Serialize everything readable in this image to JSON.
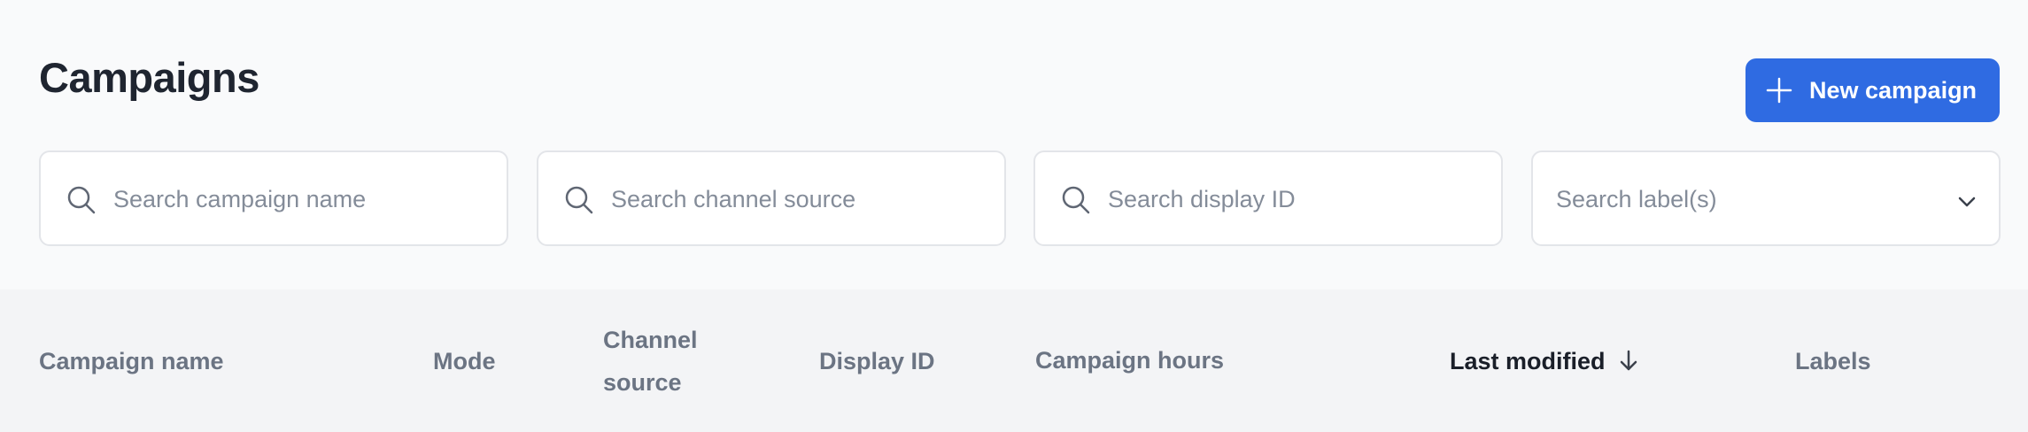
{
  "header": {
    "title": "Campaigns",
    "new_button_label": "New campaign"
  },
  "filters": {
    "campaign_name_placeholder": "Search campaign name",
    "channel_source_placeholder": "Search channel source",
    "display_id_placeholder": "Search display ID",
    "labels_placeholder": "Search label(s)"
  },
  "table": {
    "columns": [
      "Campaign name",
      "Mode",
      "Channel source",
      "Display ID",
      "Campaign hours",
      "Last modified",
      "Labels"
    ],
    "sorted_column": "Last modified",
    "sort_direction": "descending"
  },
  "colors": {
    "accent": "#2f6be2",
    "title": "#1f2530",
    "header_text": "#6b7483",
    "active_header_text": "#1a1f29",
    "table_header_bg": "#f3f4f6",
    "page_bg": "#f9fafb"
  },
  "icons": {
    "new_button": "plus-icon",
    "search": "search-icon",
    "select": "chevron-down-icon",
    "sort": "arrow-down-icon"
  }
}
